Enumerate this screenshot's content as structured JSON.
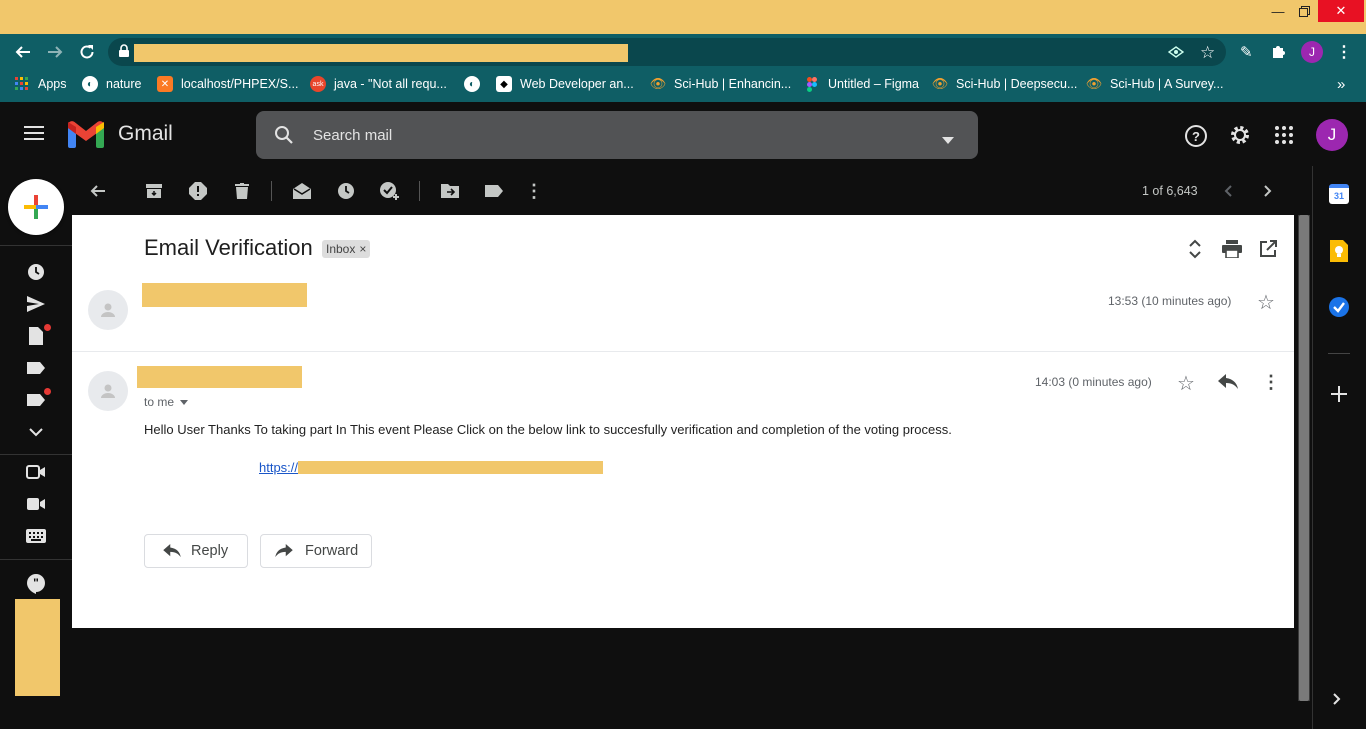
{
  "browser": {
    "bookmarks": [
      {
        "label": "Apps",
        "icon": "apps-grid-icon"
      },
      {
        "label": "nature",
        "icon": "globe-icon"
      },
      {
        "label": "localhost/PHPEX/S...",
        "icon": "xampp-icon"
      },
      {
        "label": "java - \"Not all requ...",
        "icon": "ask-icon"
      },
      {
        "label": "",
        "icon": "globe-icon"
      },
      {
        "label": "Web Developer an...",
        "icon": "diamond-icon"
      },
      {
        "label": "Sci-Hub | Enhancin...",
        "icon": "scihub-icon"
      },
      {
        "label": "Untitled – Figma",
        "icon": "figma-icon"
      },
      {
        "label": "Sci-Hub | Deepsecu...",
        "icon": "scihub-icon"
      },
      {
        "label": "Sci-Hub | A Survey...",
        "icon": "scihub-icon"
      }
    ],
    "more_bookmarks": "»",
    "profile_initial": "J"
  },
  "gmail": {
    "logo_text": "Gmail",
    "search_placeholder": "Search mail",
    "avatar_initial": "J",
    "pagination": "1 of 6,643"
  },
  "email": {
    "subject": "Email Verification",
    "label": "Inbox",
    "label_remove": "×",
    "messages": [
      {
        "time": "13:53 (10 minutes ago)"
      },
      {
        "time": "14:03 (0 minutes ago)",
        "to": "to me",
        "body": "Hello User Thanks To taking part In This event Please Click on the below link to succesfully verification and completion of the voting process.",
        "link_prefix": "https://"
      }
    ],
    "reply_label": "Reply",
    "forward_label": "Forward"
  },
  "calendar_day": "31",
  "colors": {
    "redaction": "#f1c76b",
    "toolbar": "#0f5e65",
    "gmail_bg": "#0f0f0f",
    "avatar": "#9c27b0"
  }
}
